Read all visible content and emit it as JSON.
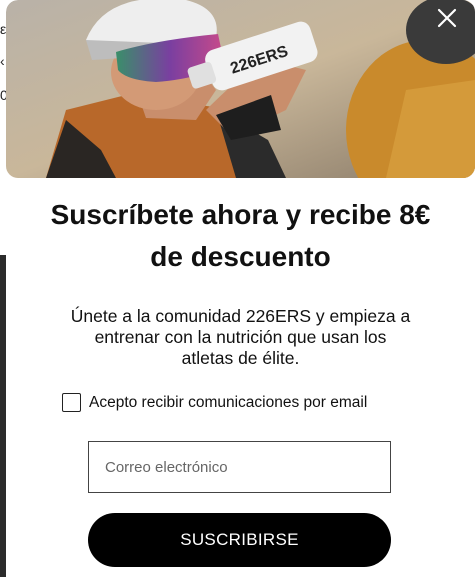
{
  "modal": {
    "title_line1": "Suscríbete ahora y recibe 8€",
    "title_line2": "de descuento",
    "description_line1": "Únete a la comunidad 226ERS y empieza a",
    "description_line2": "entrenar con la nutrición que usan los",
    "description_line3": "atletas de élite.",
    "consent_label": "Acepto recibir comunicaciones por email",
    "consent_checked": false,
    "email_placeholder": "Correo electrónico",
    "email_value": "",
    "submit_label": "SUSCRIBIRSE",
    "bottle_brand": "226ERS",
    "close_icon": "close-icon"
  },
  "background_page": {
    "fragments": [
      "ε",
      "‹",
      "0"
    ]
  },
  "colors": {
    "button_bg": "#000000",
    "button_text": "#ffffff",
    "text": "#111111"
  }
}
